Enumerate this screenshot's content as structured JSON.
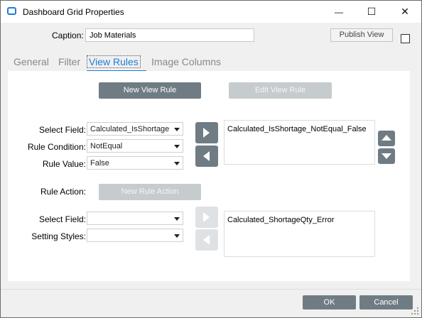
{
  "window": {
    "title": "Dashboard Grid Properties",
    "minimize_glyph": "—",
    "maximize_glyph": "☐",
    "close_glyph": "✕"
  },
  "caption": {
    "label": "Caption:",
    "value": "Job Materials"
  },
  "publish_view_label": "Publish View",
  "tabs": [
    {
      "label": "General"
    },
    {
      "label": "Filter"
    },
    {
      "label": "View Rules",
      "active": true
    },
    {
      "label": "Image Columns"
    }
  ],
  "view_rules": {
    "new_view_rule": "New View Rule",
    "edit_view_rule": "Edit View Rule",
    "select_field_label": "Select Field:",
    "select_field_value": "Calculated_IsShortage",
    "rule_condition_label": "Rule Condition:",
    "rule_condition_value": "NotEqual",
    "rule_value_label": "Rule Value:",
    "rule_value_value": "False",
    "rules_list": [
      "Calculated_IsShortage_NotEqual_False"
    ],
    "rule_action_label": "Rule Action:",
    "new_rule_action": "New Rule Action",
    "action_select_field_label": "Select Field:",
    "action_select_field_value": "",
    "setting_styles_label": "Setting Styles:",
    "setting_styles_value": "",
    "actions_list": [
      "Calculated_ShortageQty_Error"
    ]
  },
  "footer": {
    "ok": "OK",
    "cancel": "Cancel"
  },
  "colors": {
    "accent": "#1f7bd8",
    "button_dark": "#6f7c83",
    "button_disabled": "#c6cbce"
  },
  "icons": [
    "app-icon",
    "minimize-icon",
    "maximize-icon",
    "close-icon",
    "dropdown-arrow-icon",
    "arrow-right-icon",
    "arrow-left-icon",
    "arrow-up-icon",
    "arrow-down-icon",
    "resize-grip-icon"
  ]
}
